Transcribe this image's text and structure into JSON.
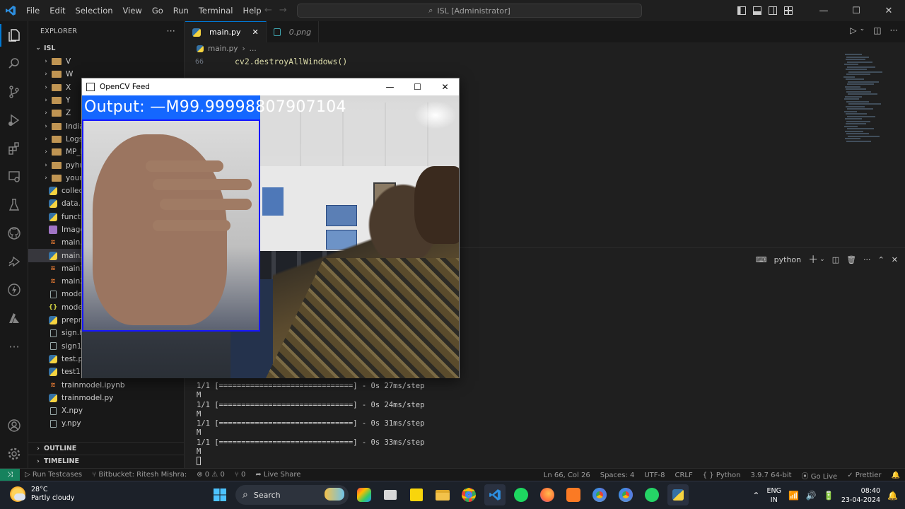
{
  "menu": [
    "File",
    "Edit",
    "Selection",
    "View",
    "Go",
    "Run",
    "Terminal",
    "Help"
  ],
  "window_title": "ISL [Administrator]",
  "explorer": {
    "header": "EXPLORER",
    "root": "ISL",
    "items": [
      {
        "type": "folder",
        "label": "V"
      },
      {
        "type": "folder",
        "label": "W"
      },
      {
        "type": "folder",
        "label": "X"
      },
      {
        "type": "folder",
        "label": "Y"
      },
      {
        "type": "folder",
        "label": "Z"
      },
      {
        "type": "folder",
        "label": "Indian"
      },
      {
        "type": "folder",
        "label": "Logs"
      },
      {
        "type": "folder",
        "label": "MP_D"
      },
      {
        "type": "folder",
        "label": "pyhun"
      },
      {
        "type": "folder",
        "label": "your_c"
      },
      {
        "type": "py",
        "label": "collec"
      },
      {
        "type": "py",
        "label": "data.p"
      },
      {
        "type": "py",
        "label": "functi"
      },
      {
        "type": "img",
        "label": "Image"
      },
      {
        "type": "nb",
        "label": "main.i"
      },
      {
        "type": "py",
        "label": "main.p"
      },
      {
        "type": "nb",
        "label": "main1"
      },
      {
        "type": "nb",
        "label": "main2"
      },
      {
        "type": "file",
        "label": "mode"
      },
      {
        "type": "json",
        "label": "mode"
      },
      {
        "type": "py",
        "label": "prepro"
      },
      {
        "type": "file",
        "label": "sign.h"
      },
      {
        "type": "file",
        "label": "sign1."
      },
      {
        "type": "py",
        "label": "test.py"
      },
      {
        "type": "py",
        "label": "test1.p"
      },
      {
        "type": "nb",
        "label": "trainmodel.ipynb"
      },
      {
        "type": "py",
        "label": "trainmodel.py"
      },
      {
        "type": "file",
        "label": "X.npy"
      },
      {
        "type": "file",
        "label": "y.npy"
      }
    ],
    "outline": "OUTLINE",
    "timeline": "TIMELINE"
  },
  "editor": {
    "tabs": [
      {
        "label": "main.py",
        "close": "✕"
      },
      {
        "label": "0.png"
      }
    ],
    "breadcrumb": [
      "main.py",
      "›",
      "..."
    ],
    "line_number": "66",
    "code": "cv2.destroyAllWindows()"
  },
  "panel": {
    "terminal_name": "python",
    "lines": [
      "1/1 [==============================] - 0s 27ms/step",
      "M",
      "1/1 [==============================] - 0s 24ms/step",
      "M",
      "1/1 [==============================] - 0s 31ms/step",
      "M",
      "1/1 [==============================] - 0s 33ms/step",
      "M"
    ]
  },
  "opencv": {
    "title": "OpenCV Feed",
    "output_text": "Output: —M99.99998807907104"
  },
  "statusbar": {
    "left": [
      "Run Testcases",
      "Bitbucket: Ritesh Mishra:",
      "⊗ 0 ⚠ 0",
      "⑂ 0",
      "Live Share"
    ],
    "right": [
      "Ln 66, Col 26",
      "Spaces: 4",
      "UTF-8",
      "CRLF",
      "Python",
      "3.9.7 64-bit",
      "Go Live",
      "Prettier"
    ]
  },
  "taskbar": {
    "temp": "28°C",
    "weather": "Partly cloudy",
    "search": "Search",
    "lang1": "ENG",
    "lang2": "IN",
    "time": "08:40",
    "date": "23-04-2024"
  },
  "colors": {
    "accent": "#0078d4",
    "output_bar": "#1467ff",
    "roi_box": "#1616ff"
  }
}
